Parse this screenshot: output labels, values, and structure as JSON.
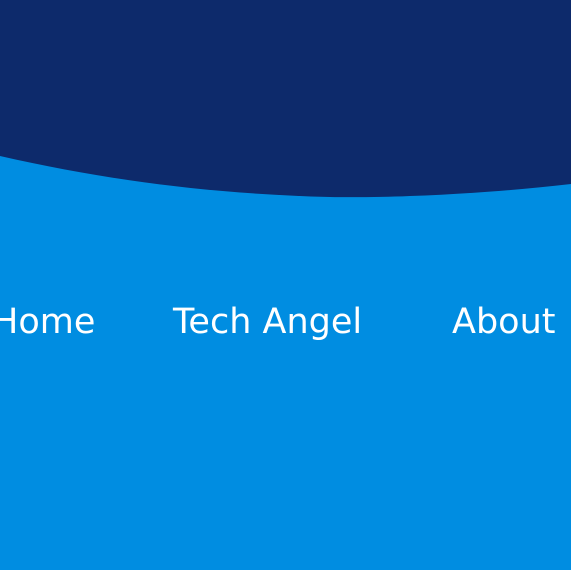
{
  "colors": {
    "header_dark": "#0d2a6b",
    "background_blue": "#008de1",
    "nav_text": "#ffffff"
  },
  "nav": {
    "items": [
      {
        "label": "Home"
      },
      {
        "label": "Tech Angel"
      },
      {
        "label": "About"
      }
    ]
  }
}
